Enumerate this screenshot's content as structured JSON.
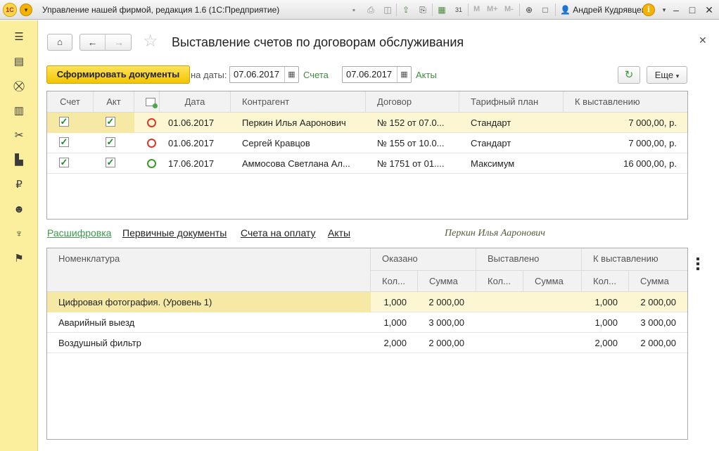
{
  "app": {
    "logo_text": "1С",
    "title": "Управление нашей фирмой, редакция 1.6  (1С:Предприятие)",
    "user": "Андрей Кудрявцев",
    "toolbar_m_labels": [
      "M",
      "M+",
      "M-"
    ],
    "calendar_day": "31"
  },
  "form": {
    "title": "Выставление счетов по договорам обслуживания",
    "generate_button": "Сформировать документы",
    "on_date_label": "на даты:",
    "invoice_date": "07.06.2017",
    "invoice_label": "Счета",
    "act_date": "07.06.2017",
    "act_label": "Акты",
    "more_button": "Еще"
  },
  "contracts": {
    "columns": {
      "invoice": "Счет",
      "act": "Акт",
      "date": "Дата",
      "counterparty": "Контрагент",
      "contract": "Договор",
      "tariff": "Тарифный план",
      "to_bill": "К выставлению"
    },
    "rows": [
      {
        "invoice": true,
        "act": true,
        "status": "red",
        "date": "01.06.2017",
        "counterparty": "Перкин Илья Ааронович",
        "contract": "№ 152 от 07.0...",
        "tariff": "Стандарт",
        "amount": "7 000,00, р."
      },
      {
        "invoice": true,
        "act": true,
        "status": "red",
        "date": "01.06.2017",
        "counterparty": "Сергей Кравцов",
        "contract": "№ 155 от 10.0...",
        "tariff": "Стандарт",
        "amount": "7 000,00, р."
      },
      {
        "invoice": true,
        "act": true,
        "status": "green",
        "date": "17.06.2017",
        "counterparty": "Аммосова Светлана Ал...",
        "contract": "№ 1751 от 01....",
        "tariff": "Максимум",
        "amount": "16 000,00, р."
      }
    ]
  },
  "tabs": {
    "decoding": "Расшифровка",
    "primary_docs": "Первичные документы",
    "invoices": "Счета на оплату",
    "acts": "Акты",
    "current_counterparty": "Перкин Илья Ааронович"
  },
  "details": {
    "columns": {
      "nomenclature": "Номенклатура",
      "rendered": "Оказано",
      "billed": "Выставлено",
      "to_bill": "К выставлению",
      "qty": "Кол...",
      "sum": "Сумма"
    },
    "rows": [
      {
        "name": "Цифровая фотография. (Уровень 1)",
        "r_qty": "1,000",
        "r_sum": "2 000,00",
        "b_qty": "",
        "b_sum": "",
        "t_qty": "1,000",
        "t_sum": "2 000,00"
      },
      {
        "name": "Аварийный выезд",
        "r_qty": "1,000",
        "r_sum": "3 000,00",
        "b_qty": "",
        "b_sum": "",
        "t_qty": "1,000",
        "t_sum": "3 000,00"
      },
      {
        "name": "Воздушный фильтр",
        "r_qty": "2,000",
        "r_sum": "2 000,00",
        "b_qty": "",
        "b_sum": "",
        "t_qty": "2,000",
        "t_sum": "2 000,00"
      }
    ]
  },
  "colors": {
    "accent_yellow": "#f2c500",
    "section_panel": "#fbef9e",
    "selected_row": "#fcf6d2",
    "link_green": "#3f9a4f",
    "status_red": "#d93a28",
    "status_green": "#3a9a2a"
  },
  "icons": {
    "sections": [
      "menu-icon",
      "desktop-icon",
      "basket-icon",
      "warehouse-icon",
      "tools-icon",
      "factory-icon",
      "ruble-icon",
      "people-icon",
      "emblem-icon",
      "flag-icon"
    ]
  }
}
